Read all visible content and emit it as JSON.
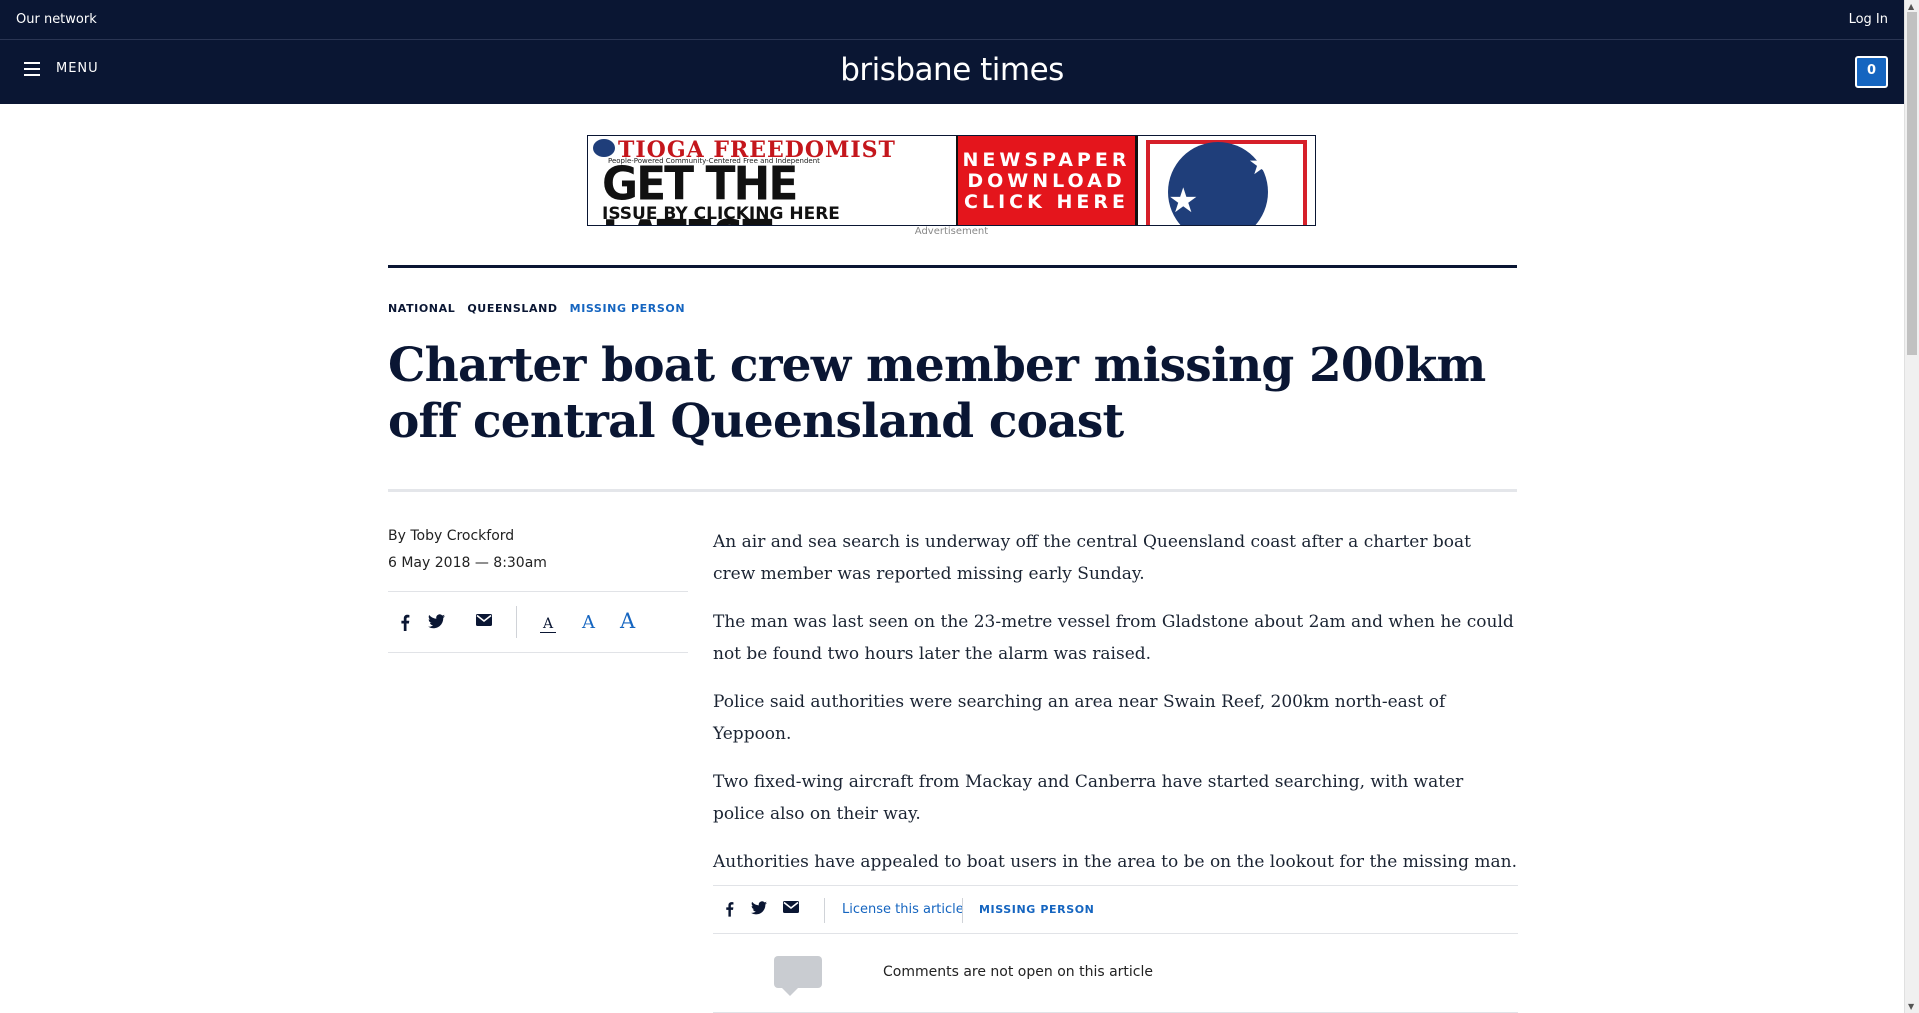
{
  "network_bar": {
    "our_network": "Our network",
    "login": "Log In"
  },
  "masthead": {
    "menu_label": "MENU",
    "brand": "brisbane times",
    "count": "0"
  },
  "ad": {
    "brand": "TIOGA FREEDOMIST",
    "tagline": "People-Powered   Community-Centered   Free and Independent",
    "headline": "GET THE LATEST",
    "subline": "ISSUE BY CLICKING HERE",
    "cta_line1": "NEWSPAPER",
    "cta_line2": "DOWNLOAD",
    "cta_line3": "CLICK HERE",
    "caption": "Advertisement"
  },
  "breadcrumb": {
    "national": "NATIONAL",
    "queensland": "QUEENSLAND",
    "tag": "MISSING PERSON"
  },
  "article": {
    "headline": "Charter boat crew member missing 200km off central Queensland coast",
    "byline": "By Toby Crockford",
    "date": "6 May 2018 — 8:30am",
    "paragraphs": [
      "An air and sea search is underway off the central Queensland coast after a charter boat crew member was reported missing early Sunday.",
      "The man was last seen on the 23-metre vessel from Gladstone about 2am and when he could not be found two hours later the alarm was raised.",
      "Police said authorities were searching an area near Swain Reef, 200km north-east of Yeppoon.",
      "Two fixed-wing aircraft from Mackay and Canberra have started searching, with water police also on their way.",
      "Authorities have appealed to boat users in the area to be on the lookout for the missing man."
    ]
  },
  "font_size_controls": {
    "small": "A",
    "medium": "A",
    "large": "A"
  },
  "share_bar": {
    "license": "License this article",
    "tag": "MISSING PERSON"
  },
  "comments": {
    "text": "Comments are not open on this article"
  },
  "icons": {
    "facebook": "facebook-icon",
    "twitter": "twitter-icon",
    "email": "email-icon",
    "menu": "hamburger-icon",
    "comment": "comment-bubble-icon"
  },
  "colors": {
    "navy": "#0a1633",
    "link_blue": "#1565c0",
    "ad_red": "#e4151c"
  }
}
